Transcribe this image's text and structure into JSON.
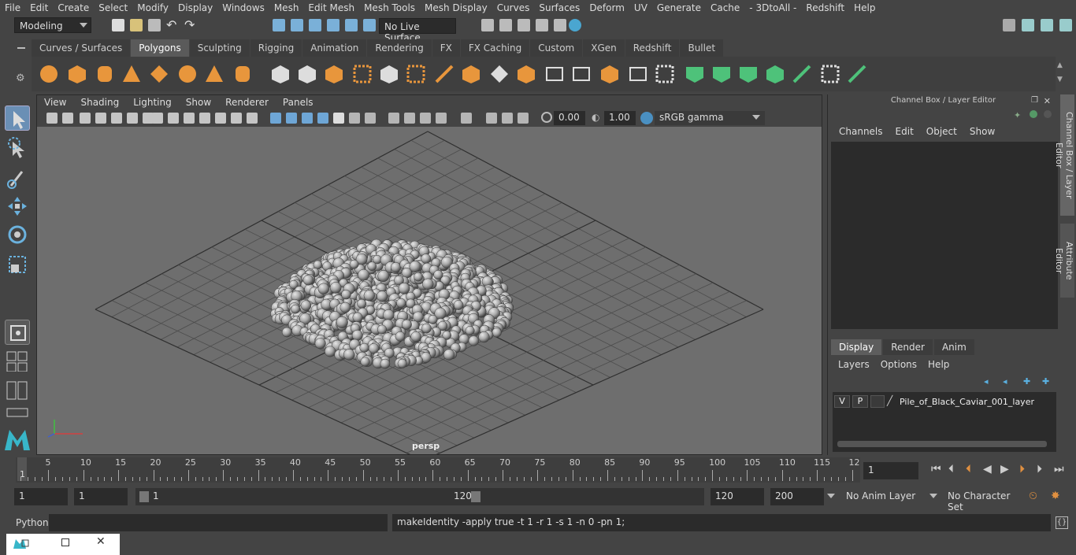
{
  "menubar": [
    "File",
    "Edit",
    "Create",
    "Select",
    "Modify",
    "Display",
    "Windows",
    "Mesh",
    "Edit Mesh",
    "Mesh Tools",
    "Mesh Display",
    "Curves",
    "Surfaces",
    "Deform",
    "UV",
    "Generate",
    "Cache",
    "- 3DtoAll -",
    "Redshift",
    "Help"
  ],
  "status": {
    "workspace": "Modeling",
    "live_surface": "No Live Surface"
  },
  "shelf_tabs": [
    "Curves / Surfaces",
    "Polygons",
    "Sculpting",
    "Rigging",
    "Animation",
    "Rendering",
    "FX",
    "FX Caching",
    "Custom",
    "XGen",
    "Redshift",
    "Bullet"
  ],
  "shelf_active": "Polygons",
  "viewport": {
    "menu": [
      "View",
      "Shading",
      "Lighting",
      "Show",
      "Renderer",
      "Panels"
    ],
    "exposure": "0.00",
    "gamma": "1.00",
    "color_space": "sRGB gamma",
    "camera_label": "persp"
  },
  "channel_box": {
    "title": "Channel Box / Layer Editor",
    "menu": [
      "Channels",
      "Edit",
      "Object",
      "Show"
    ]
  },
  "layer_editor": {
    "tabs": [
      "Display",
      "Render",
      "Anim"
    ],
    "active_tab": "Display",
    "menu": [
      "Layers",
      "Options",
      "Help"
    ],
    "layer": {
      "v": "V",
      "p": "P",
      "name": "Pile_of_Black_Caviar_001_layer"
    }
  },
  "side_tabs": [
    "Channel Box / Layer Editor",
    "Attribute Editor"
  ],
  "timeline": {
    "ticks": [
      "5",
      "10",
      "15",
      "20",
      "25",
      "30",
      "35",
      "40",
      "45",
      "50",
      "55",
      "60",
      "65",
      "70",
      "75",
      "80",
      "85",
      "90",
      "95",
      "100",
      "105",
      "110",
      "115",
      "12"
    ],
    "start_marker": "1",
    "current_frame": "1"
  },
  "range": {
    "start": "1",
    "playback_start": "1",
    "slider_start": "1",
    "slider_end": "120",
    "playback_end": "120",
    "end": "200",
    "anim_layer": "No Anim Layer",
    "character_set": "No Character Set"
  },
  "command": {
    "language": "Python",
    "output": "makeIdentity -apply true -t 1 -r 1 -s 1 -n 0 -pn 1;"
  }
}
